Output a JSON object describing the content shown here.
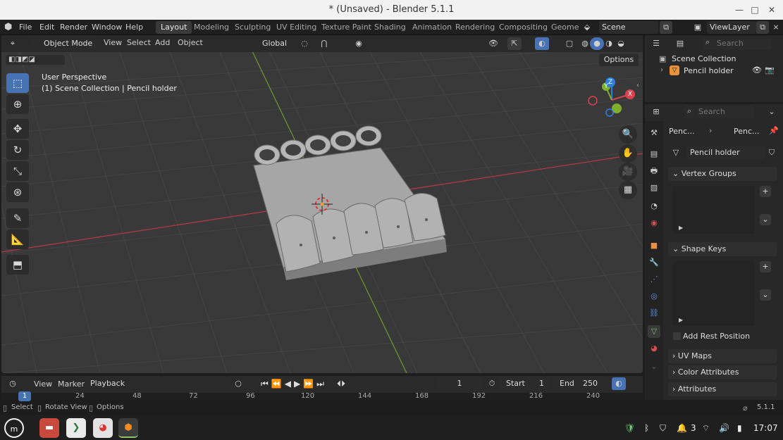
{
  "window": {
    "title": "* (Unsaved) - Blender 5.1.1",
    "minimize": "—",
    "maximize": "□",
    "close": "✕"
  },
  "menu": [
    "File",
    "Edit",
    "Render",
    "Window",
    "Help"
  ],
  "workspaces": [
    "Layout",
    "Modeling",
    "Sculpting",
    "UV Editing",
    "Texture Paint",
    "Shading",
    "Animation",
    "Rendering",
    "Compositing",
    "Geome"
  ],
  "scene": "Scene",
  "view_layer": "ViewLayer",
  "viewport": {
    "mode": "Object Mode",
    "menus": [
      "View",
      "Select",
      "Add",
      "Object"
    ],
    "transform": "Global",
    "options": "Options",
    "info_line1": "User Perspective",
    "info_line2": "(1) Scene Collection | Pencil holder",
    "gizmo": {
      "x": "X",
      "y": "Y",
      "z": "Z"
    }
  },
  "outliner": {
    "search_placeholder": "Search",
    "collection": "Scene Collection",
    "object": "Pencil holder"
  },
  "properties": {
    "search_placeholder": "Search",
    "breadcrumb": [
      "Penc...",
      "Penc..."
    ],
    "mesh_name": "Pencil holder",
    "vertex_groups": "Vertex Groups",
    "shape_keys": "Shape Keys",
    "add_rest_position": "Add Rest Position",
    "uv_maps": "UV Maps",
    "color_attributes": "Color Attributes",
    "attributes": "Attributes"
  },
  "timeline": {
    "menus": [
      "View",
      "Marker",
      "Playback"
    ],
    "current_frame": "1",
    "start_label": "Start",
    "start": "1",
    "end_label": "End",
    "end": "250",
    "ruler": [
      "1",
      "24",
      "48",
      "72",
      "96",
      "120",
      "144",
      "168",
      "192",
      "216",
      "240"
    ]
  },
  "statusbar": {
    "select": "Select",
    "rotate": "Rotate View",
    "options": "Options",
    "version": "5.1.1"
  },
  "taskbar": {
    "time": "17:07",
    "notif_count": "3"
  },
  "colors": {
    "accent": "#4772b3",
    "x_axis": "#d9424e",
    "y_axis": "#7fb02c",
    "z_axis": "#2e7fe0"
  }
}
